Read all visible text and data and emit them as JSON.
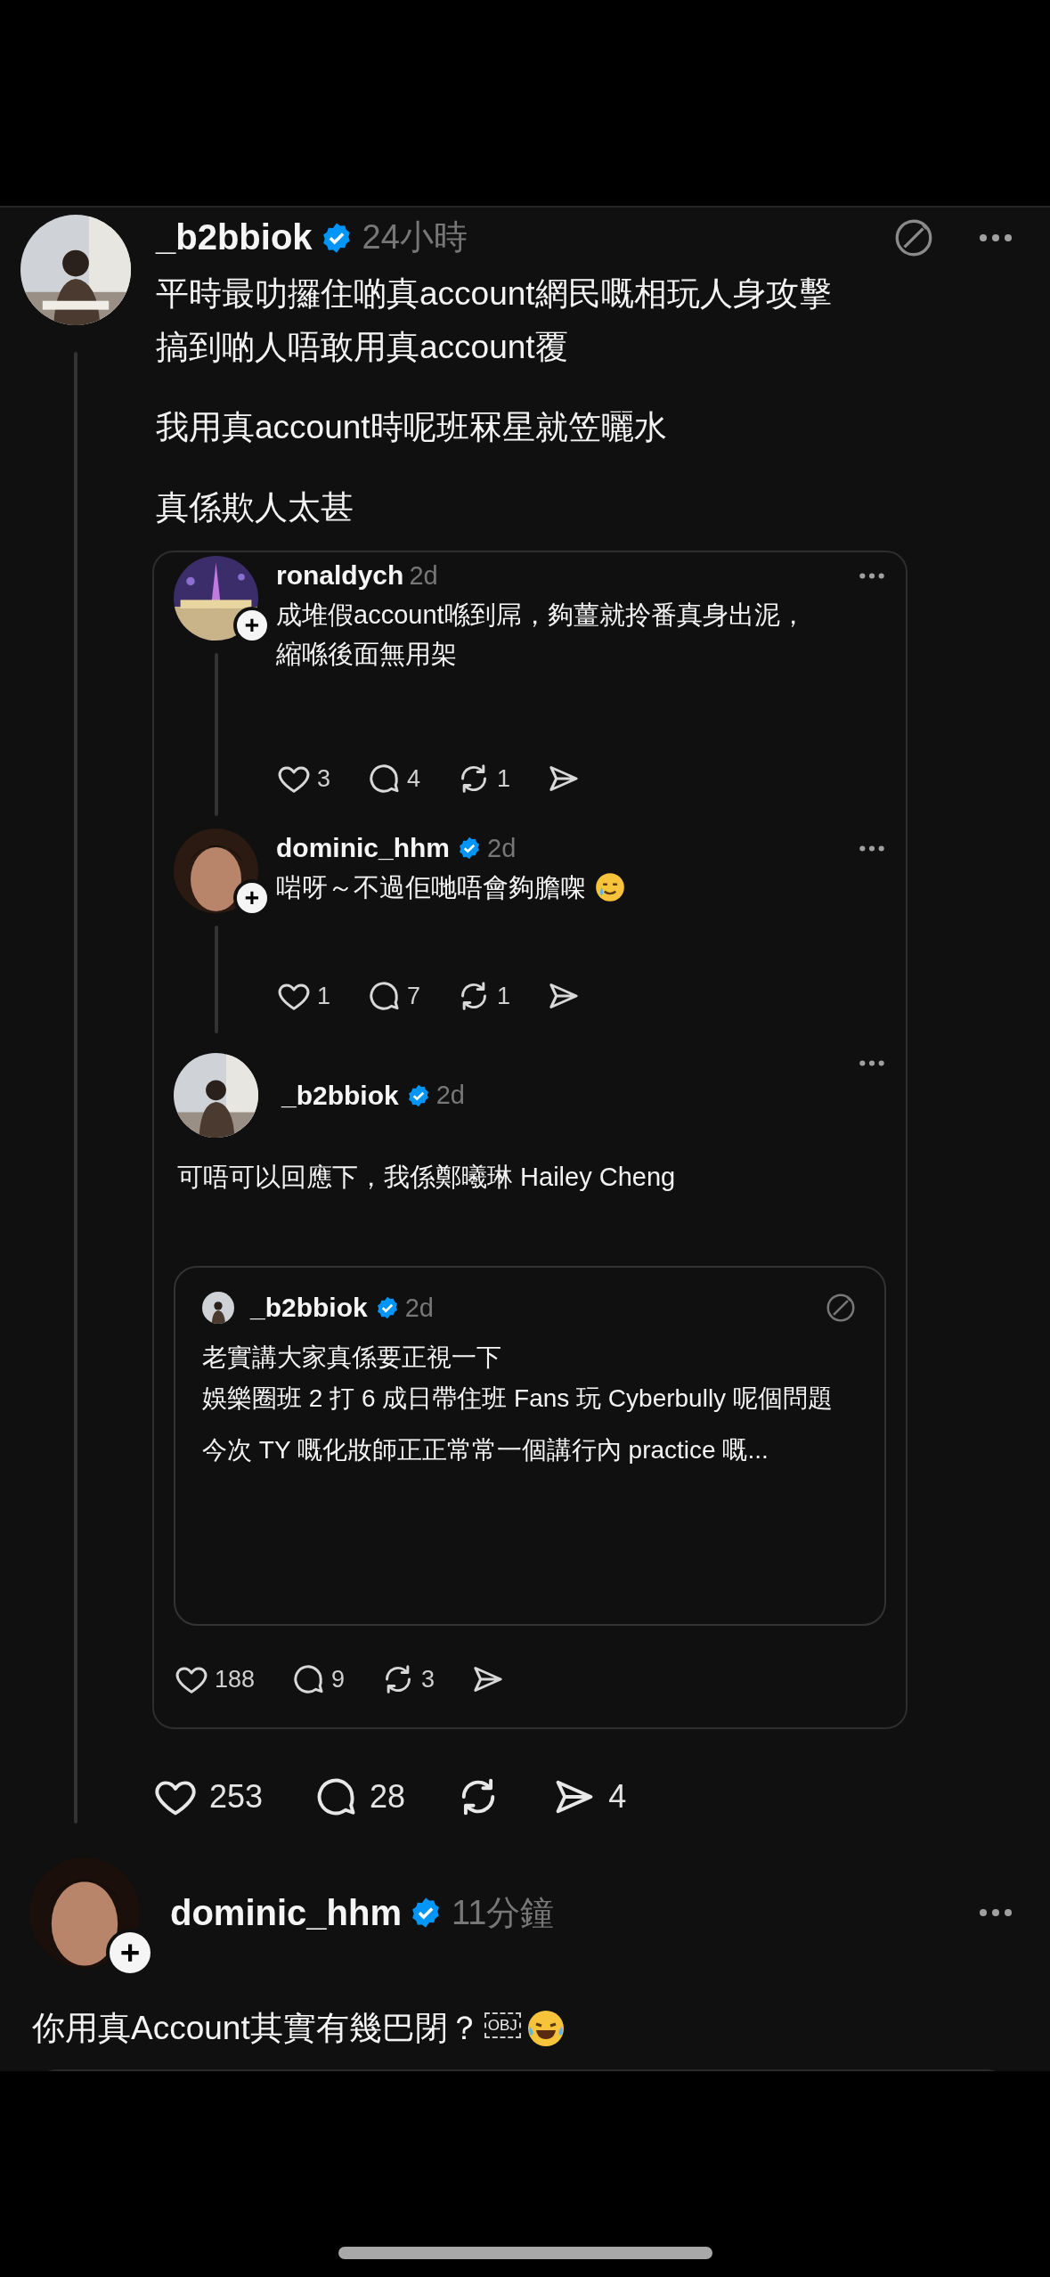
{
  "post": {
    "author": "_b2bbiok",
    "verified": true,
    "time": "24小時",
    "body": [
      "平時最叻攞住啲真account網民嘅相玩人身攻擊搞到啲人唔敢用真account覆",
      "我用真account時呢班冧星就笠曬水",
      "真係欺人太甚"
    ],
    "embedded": {
      "replies": [
        {
          "author": "ronaldych",
          "time": "2d",
          "follow": true,
          "body": "成堆假account喺到屌，夠薑就拎番真身出泥，縮喺後面無用架",
          "actions": [
            {
              "kind": "like",
              "count": "3"
            },
            {
              "kind": "reply",
              "count": "4"
            },
            {
              "kind": "repost",
              "count": "1"
            },
            {
              "kind": "share"
            }
          ]
        },
        {
          "author": "dominic_hhm",
          "verified": true,
          "time": "2d",
          "follow": true,
          "body": "啱呀～不過佢哋唔會夠膽㗎",
          "trailing_emoji": true,
          "actions": [
            {
              "kind": "like",
              "count": "1"
            },
            {
              "kind": "reply",
              "count": "7"
            },
            {
              "kind": "repost",
              "count": "1"
            },
            {
              "kind": "share"
            }
          ]
        }
      ],
      "reply": {
        "author": "_b2bbiok",
        "verified": true,
        "time": "2d",
        "body": "可唔可以回應下，我係鄭曦琳 Hailey Cheng",
        "quote": {
          "author": "_b2bbiok",
          "verified": true,
          "time": "2d",
          "body": [
            "老實講大家真係要正視一下",
            "娛樂圈班 2 打 6 成日帶住班 Fans 玩 Cyberbully 呢個問題",
            "今次 TY 嘅化妝師正正常常一個講行內 practice 嘅..."
          ]
        },
        "actions": [
          {
            "kind": "like",
            "count": "188"
          },
          {
            "kind": "reply",
            "count": "9"
          },
          {
            "kind": "repost",
            "count": "3"
          },
          {
            "kind": "share"
          }
        ]
      }
    },
    "actions": [
      {
        "kind": "like",
        "count": "253"
      },
      {
        "kind": "reply",
        "count": "28"
      },
      {
        "kind": "repost"
      },
      {
        "kind": "share",
        "count": "4"
      }
    ]
  },
  "next_post": {
    "author": "dominic_hhm",
    "verified": true,
    "time": "11分鐘",
    "follow": true,
    "body": "你用真Account其實有幾巴閉？",
    "object_placeholder": "OBJ",
    "trailing_emoji": true
  }
}
